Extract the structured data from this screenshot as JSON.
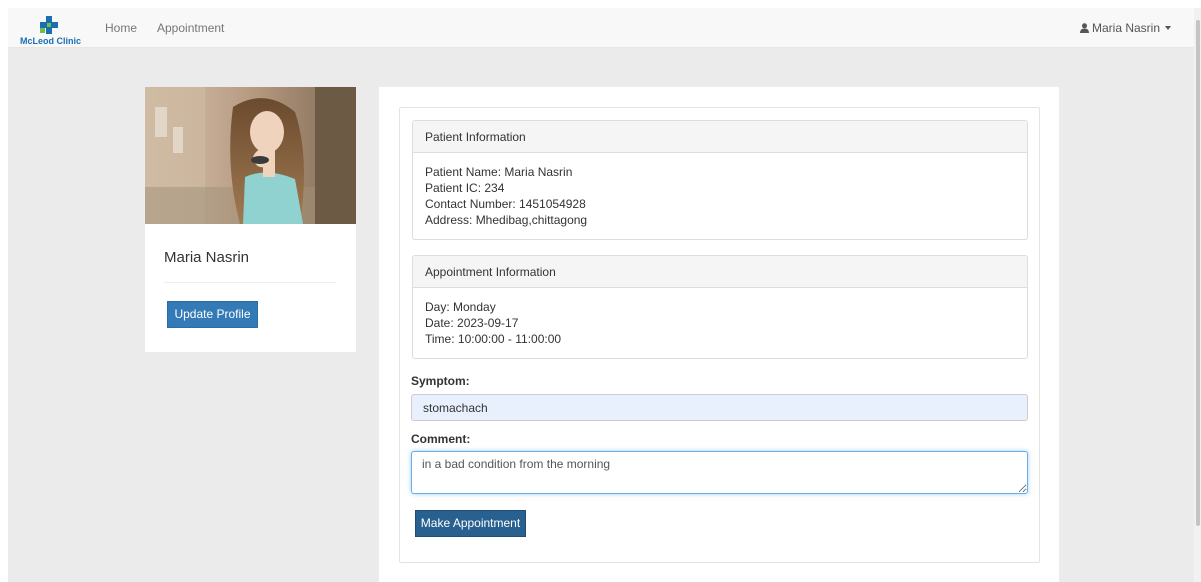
{
  "navbar": {
    "brand_text": "McLeod Clinic",
    "links": {
      "home": "Home",
      "appointment": "Appointment"
    },
    "user_name": "Maria Nasrin",
    "user_icon": "user-icon",
    "brand_color": "#1a6fb3"
  },
  "profile": {
    "name": "Maria Nasrin",
    "update_button": "Update Profile"
  },
  "patient_panel": {
    "title": "Patient Information",
    "lines": [
      "Patient Name: Maria Nasrin",
      "Patient IC: 234",
      "Contact Number: 1451054928",
      "Address: Mhedibag,chittagong"
    ]
  },
  "appointment_panel": {
    "title": "Appointment Information",
    "lines": [
      "Day: Monday",
      "Date: 2023-09-17",
      "Time: 10:00:00 - 11:00:00"
    ]
  },
  "form": {
    "symptom_label": "Symptom:",
    "symptom_value": "stomachach",
    "comment_label": "Comment:",
    "comment_value": "in a bad condition from the morning",
    "submit_label": "Make Appointment"
  },
  "colors": {
    "primary": "#337ab7",
    "primary_active": "#286090",
    "page_bg": "#ebebeb"
  }
}
